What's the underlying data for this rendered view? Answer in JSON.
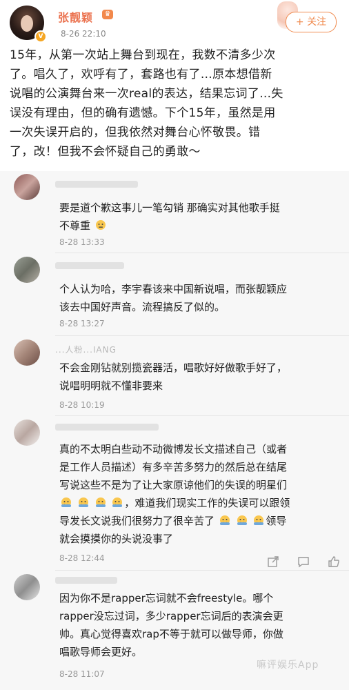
{
  "post": {
    "user_name": "张靓颖",
    "time": "8-26 22:10",
    "follow_label": "+ 关注",
    "lines": [
      "15年，从第一次站上舞台到现在，我数不清多少次",
      "了。唱久了，欢呼有了，套路也有了…原本想借新",
      "说唱的公演舞台来一次real的表达，结果忘词了…失",
      "误没有理由，但的确有遗憾。下个15年，虽然是用",
      "一次失误开启的，但我依然对舞台心怀敬畏。错",
      "了，改！但我不会怀疑自己的勇敢～"
    ]
  },
  "comments": [
    {
      "lines": [
        "要是道个歉这事儿一笔勾销 那确实对其他歌手挺",
        "不尊重"
      ],
      "time": "8-28 13:33"
    },
    {
      "lines": [
        "个人认为哈，李宇春该来中国新说唱，而张靓颖应",
        "该去中国好声音。流程搞反了似的。"
      ],
      "time": "8-28 13:27"
    },
    {
      "user": "...人粉...IANG",
      "lines": [
        "不会金刚钻就别揽瓷器活，唱歌好好做歌手好了，",
        "说唱明明就不懂非要来"
      ],
      "time": "8-28 10:19"
    },
    {
      "lines": [
        "真的不太明白些动不动微博发长文描述自己（或者",
        "是工作人员描述）有多辛苦多努力的然后总在结尾",
        "写说这些不是为了让大家原谅他们的失误的明星们",
        "，难道我们现实工作的失误可以跟领",
        "导发长文说我们很努力了很辛苦了",
        "领导",
        "就会摸摸你的头说没事了"
      ],
      "time": "8-28 12:44"
    },
    {
      "lines": [
        "因为你不是rapper忘词就不会freestyle。哪个",
        "rapper没忘过词，多少rapper忘词后的表演会更",
        "帅。真心觉得喜欢rap不等于就可以做导师，你做",
        "唱歌导师会更好。"
      ],
      "time": "8-28 11:07"
    }
  ],
  "watermark": "嘛评娱乐App",
  "colors": {
    "accent": "#eb7350",
    "follow": "#f08b4f",
    "comment_bg": "#f7f7f7"
  },
  "icons": [
    "share-icon",
    "comment-icon",
    "like-icon",
    "emoji-icon"
  ]
}
